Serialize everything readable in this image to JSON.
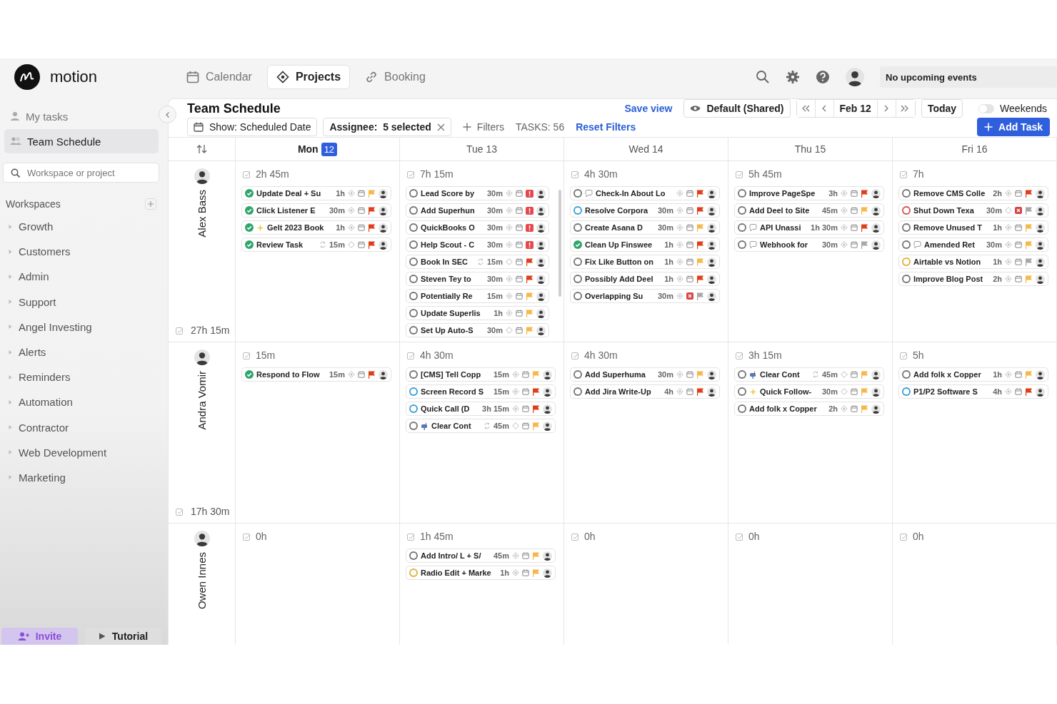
{
  "app": {
    "logo": "motion"
  },
  "nav": [
    {
      "label": "Calendar",
      "selected": false
    },
    {
      "label": "Projects",
      "selected": true
    },
    {
      "label": "Booking",
      "selected": false
    }
  ],
  "events_field": {
    "value": "No upcoming events"
  },
  "sidebar": {
    "items": [
      {
        "label": "My tasks",
        "selected": false
      },
      {
        "label": "Team Schedule",
        "selected": true
      }
    ],
    "search": {
      "placeholder": "Workspace or project"
    },
    "workspaces_title": "Workspaces",
    "workspaces": [
      {
        "label": "Growth",
        "expanded": false
      },
      {
        "label": "Customers",
        "expanded": false
      },
      {
        "label": "Admin",
        "expanded": false
      },
      {
        "label": "Support",
        "expanded": false
      },
      {
        "label": "Angel Investing",
        "expanded": false
      },
      {
        "label": "Alerts",
        "expanded": false
      },
      {
        "label": "Reminders",
        "expanded": false
      },
      {
        "label": "Automation",
        "expanded": false
      },
      {
        "label": "Contractor",
        "expanded": false
      },
      {
        "label": "Web Development",
        "expanded": false
      },
      {
        "label": "Marketing",
        "expanded": false
      }
    ],
    "footer": [
      {
        "label": "Invite",
        "kind": "invite"
      },
      {
        "label": "Tutorial",
        "kind": "tutorial"
      }
    ]
  },
  "toolbar": {
    "title": "Team Schedule",
    "save_view": "Save view",
    "view": "Default (Shared)",
    "date": "Feb 12",
    "today": "Today",
    "weekends": {
      "label": "Weekends",
      "on": false
    },
    "show": "Show: Scheduled Date",
    "assignee": "Assignee:  5 selected",
    "filters": "Filters",
    "tasks_count": "TASKS: 56",
    "reset": "Reset Filters",
    "add_task": "Add Task"
  },
  "days": [
    {
      "label": "Mon",
      "date": "12",
      "today": true
    },
    {
      "label": "Tue",
      "date": "13",
      "today": false
    },
    {
      "label": "Wed",
      "date": "14",
      "today": false
    },
    {
      "label": "Thu",
      "date": "15",
      "today": false
    },
    {
      "label": "Fri",
      "date": "16",
      "today": false
    }
  ],
  "rows": [
    {
      "name": "Alex Bass",
      "total": "27h 15m",
      "cells": [
        {
          "total": "2h 45m",
          "scrollable": false,
          "tasks": [
            {
              "done": true,
              "color": "#2ea56b",
              "kind": "plain",
              "title": "Update Deal + Su",
              "recurring": false,
              "duration": "1h",
              "scheduled": true,
              "deadline_missed": false,
              "priority": {
                "urgent": false,
                "color": "#f5b84a"
              }
            },
            {
              "done": true,
              "color": "#2ea56b",
              "kind": "plain",
              "title": "Click Listener E",
              "recurring": false,
              "duration": "30m",
              "scheduled": true,
              "deadline_missed": false,
              "priority": {
                "urgent": false,
                "color": "#e03e1a"
              }
            },
            {
              "done": true,
              "color": "#2ea56b",
              "kind": "sparkle",
              "title": "Gelt 2023 Book",
              "recurring": false,
              "duration": "1h",
              "scheduled": true,
              "deadline_missed": false,
              "priority": {
                "urgent": false,
                "color": "#e03e1a"
              }
            },
            {
              "done": true,
              "color": "#2ea56b",
              "kind": "plain",
              "title": "Review Task",
              "recurring": true,
              "duration": "15m",
              "scheduled": false,
              "deadline_missed": false,
              "priority": {
                "urgent": false,
                "color": "#e03e1a"
              }
            }
          ]
        },
        {
          "total": "7h 15m",
          "scrollable": true,
          "tasks": [
            {
              "done": false,
              "color": "#777777",
              "kind": "plain",
              "title": "Lead Score by",
              "recurring": false,
              "duration": "30m",
              "scheduled": true,
              "deadline_missed": false,
              "priority": {
                "urgent": true,
                "color": "#e5484d"
              }
            },
            {
              "done": false,
              "color": "#777777",
              "kind": "plain",
              "title": "Add Superhun",
              "recurring": false,
              "duration": "30m",
              "scheduled": true,
              "deadline_missed": false,
              "priority": {
                "urgent": true,
                "color": "#e5484d"
              }
            },
            {
              "done": false,
              "color": "#777777",
              "kind": "plain",
              "title": "QuickBooks O",
              "recurring": false,
              "duration": "30m",
              "scheduled": true,
              "deadline_missed": false,
              "priority": {
                "urgent": true,
                "color": "#e5484d"
              }
            },
            {
              "done": false,
              "color": "#777777",
              "kind": "plain",
              "title": "Help Scout - C",
              "recurring": false,
              "duration": "30m",
              "scheduled": true,
              "deadline_missed": false,
              "priority": {
                "urgent": true,
                "color": "#e5484d"
              }
            },
            {
              "done": false,
              "color": "#777777",
              "kind": "plain",
              "title": "Book In SEC",
              "recurring": true,
              "duration": "15m",
              "scheduled": false,
              "deadline_missed": false,
              "priority": {
                "urgent": false,
                "color": "#e03e1a"
              }
            },
            {
              "done": false,
              "color": "#777777",
              "kind": "plain",
              "title": "Steven Tey to",
              "recurring": false,
              "duration": "30m",
              "scheduled": true,
              "deadline_missed": false,
              "priority": {
                "urgent": false,
                "color": "#e03e1a"
              }
            },
            {
              "done": false,
              "color": "#777777",
              "kind": "plain",
              "title": "Potentially Re",
              "recurring": false,
              "duration": "15m",
              "scheduled": true,
              "deadline_missed": false,
              "priority": {
                "urgent": false,
                "color": "#f5b84a"
              }
            },
            {
              "done": false,
              "color": "#777777",
              "kind": "plain",
              "title": "Update Superlis",
              "recurring": false,
              "duration": "1h",
              "scheduled": true,
              "deadline_missed": false,
              "priority": {
                "urgent": false,
                "color": "#f5b84a"
              }
            },
            {
              "done": false,
              "color": "#777777",
              "kind": "plain",
              "title": "Set Up Auto-S",
              "recurring": false,
              "duration": "30m",
              "scheduled": false,
              "deadline_missed": false,
              "priority": {
                "urgent": false,
                "color": "#f5b84a"
              }
            }
          ]
        },
        {
          "total": "4h 30m",
          "scrollable": false,
          "tasks": [
            {
              "done": false,
              "color": "#777777",
              "kind": "chat",
              "title": "Check-In About Lo",
              "recurring": false,
              "scheduled": true,
              "deadline_missed": false,
              "priority": {
                "urgent": false,
                "color": "#e03e1a"
              }
            },
            {
              "done": false,
              "color": "#3aa0d8",
              "kind": "plain",
              "title": "Resolve Corpora",
              "recurring": false,
              "duration": "30m",
              "scheduled": true,
              "deadline_missed": false,
              "priority": {
                "urgent": false,
                "color": "#e03e1a"
              }
            },
            {
              "done": false,
              "color": "#777777",
              "kind": "plain",
              "title": "Create Asana D",
              "recurring": false,
              "duration": "30m",
              "scheduled": true,
              "deadline_missed": false,
              "priority": {
                "urgent": false,
                "color": "#f5b84a"
              }
            },
            {
              "done": true,
              "color": "#2ea56b",
              "kind": "plain",
              "title": "Clean Up Finswee",
              "recurring": false,
              "duration": "1h",
              "scheduled": true,
              "deadline_missed": false,
              "priority": {
                "urgent": false,
                "color": "#e03e1a"
              }
            },
            {
              "done": false,
              "color": "#777777",
              "kind": "plain",
              "title": "Fix Like Button on",
              "recurring": false,
              "duration": "1h",
              "scheduled": true,
              "deadline_missed": false,
              "priority": {
                "urgent": false,
                "color": "#f5b84a"
              }
            },
            {
              "done": false,
              "color": "#777777",
              "kind": "plain",
              "title": "Possibly Add Deel",
              "recurring": false,
              "duration": "1h",
              "scheduled": true,
              "deadline_missed": false,
              "priority": {
                "urgent": false,
                "color": "#e03e1a"
              }
            },
            {
              "done": false,
              "color": "#777777",
              "kind": "plain",
              "title": "Overlapping Su",
              "recurring": false,
              "duration": "30m",
              "scheduled": true,
              "deadline_missed": true,
              "priority": {
                "urgent": false,
                "color": "#a8a8a8"
              }
            }
          ]
        },
        {
          "total": "5h 45m",
          "scrollable": false,
          "tasks": [
            {
              "done": false,
              "color": "#777777",
              "kind": "plain",
              "title": "Improve PageSpe",
              "recurring": false,
              "duration": "3h",
              "scheduled": true,
              "deadline_missed": false,
              "priority": {
                "urgent": false,
                "color": "#e03e1a"
              }
            },
            {
              "done": false,
              "color": "#777777",
              "kind": "plain",
              "title": "Add Deel to Site",
              "recurring": false,
              "duration": "45m",
              "scheduled": true,
              "deadline_missed": false,
              "priority": {
                "urgent": false,
                "color": "#f5b84a"
              }
            },
            {
              "done": false,
              "color": "#777777",
              "kind": "chat",
              "title": "API Unassi",
              "recurring": false,
              "duration": "1h 30m",
              "scheduled": true,
              "deadline_missed": false,
              "priority": {
                "urgent": false,
                "color": "#e03e1a"
              }
            },
            {
              "done": false,
              "color": "#777777",
              "kind": "chat",
              "title": "Webhook for",
              "recurring": false,
              "duration": "30m",
              "scheduled": true,
              "deadline_missed": false,
              "priority": {
                "urgent": false,
                "color": "#a8a8a8"
              }
            }
          ]
        },
        {
          "total": "7h",
          "scrollable": false,
          "tasks": [
            {
              "done": false,
              "color": "#777777",
              "kind": "plain",
              "title": "Remove CMS Colle",
              "recurring": false,
              "duration": "2h",
              "scheduled": true,
              "deadline_missed": false,
              "priority": {
                "urgent": false,
                "color": "#e03e1a"
              }
            },
            {
              "done": false,
              "color": "#d9534f",
              "kind": "plain",
              "title": "Shut Down Texa",
              "recurring": false,
              "duration": "30m",
              "scheduled": false,
              "deadline_missed": true,
              "priority": {
                "urgent": false,
                "color": "#a8a8a8"
              }
            },
            {
              "done": false,
              "color": "#777777",
              "kind": "plain",
              "title": "Remove Unused T",
              "recurring": false,
              "duration": "1h",
              "scheduled": true,
              "deadline_missed": false,
              "priority": {
                "urgent": false,
                "color": "#f5b84a"
              }
            },
            {
              "done": false,
              "color": "#777777",
              "kind": "chat",
              "title": "Amended Ret",
              "recurring": false,
              "duration": "30m",
              "scheduled": true,
              "deadline_missed": false,
              "priority": {
                "urgent": false,
                "color": "#f5b84a"
              }
            },
            {
              "done": false,
              "color": "#e2b33c",
              "kind": "plain",
              "title": "Airtable vs Notion",
              "recurring": false,
              "duration": "1h",
              "scheduled": true,
              "deadline_missed": false,
              "priority": {
                "urgent": false,
                "color": "#a8a8a8"
              }
            },
            {
              "done": false,
              "color": "#777777",
              "kind": "plain",
              "title": "Improve Blog Post",
              "recurring": false,
              "duration": "2h",
              "scheduled": true,
              "deadline_missed": false,
              "priority": {
                "urgent": false,
                "color": "#f5b84a"
              }
            }
          ]
        }
      ]
    },
    {
      "name": "Andra Vomir",
      "total": "17h 30m",
      "cells": [
        {
          "total": "15m",
          "scrollable": false,
          "tasks": [
            {
              "done": true,
              "color": "#2ea56b",
              "kind": "plain",
              "title": "Respond to Flow",
              "recurring": false,
              "duration": "15m",
              "scheduled": true,
              "deadline_missed": false,
              "priority": {
                "urgent": false,
                "color": "#e03e1a"
              }
            }
          ]
        },
        {
          "total": "4h 30m",
          "scrollable": false,
          "tasks": [
            {
              "done": false,
              "color": "#777777",
              "kind": "plain",
              "title": "[CMS] Tell Copp",
              "recurring": false,
              "duration": "15m",
              "scheduled": true,
              "deadline_missed": false,
              "priority": {
                "urgent": false,
                "color": "#f5b84a"
              }
            },
            {
              "done": false,
              "color": "#3aa0d8",
              "kind": "plain",
              "title": "Screen Record S",
              "recurring": false,
              "duration": "15m",
              "scheduled": true,
              "deadline_missed": false,
              "priority": {
                "urgent": false,
                "color": "#e03e1a"
              }
            },
            {
              "done": false,
              "color": "#3aa0d8",
              "kind": "plain",
              "title": "Quick Call (D",
              "recurring": false,
              "duration": "3h 15m",
              "scheduled": true,
              "deadline_missed": false,
              "priority": {
                "urgent": false,
                "color": "#e03e1a"
              }
            },
            {
              "done": false,
              "color": "#777777",
              "kind": "mailbox",
              "title": "Clear Cont",
              "recurring": true,
              "duration": "45m",
              "scheduled": false,
              "deadline_missed": false,
              "priority": {
                "urgent": false,
                "color": "#f5b84a"
              }
            }
          ]
        },
        {
          "total": "4h 30m",
          "scrollable": false,
          "tasks": [
            {
              "done": false,
              "color": "#777777",
              "kind": "plain",
              "title": "Add Superhuma",
              "recurring": false,
              "duration": "30m",
              "scheduled": true,
              "deadline_missed": false,
              "priority": {
                "urgent": false,
                "color": "#f5b84a"
              }
            },
            {
              "done": false,
              "color": "#777777",
              "kind": "plain",
              "title": "Add Jira Write-Up",
              "recurring": false,
              "duration": "4h",
              "scheduled": true,
              "deadline_missed": false,
              "priority": {
                "urgent": false,
                "color": "#e03e1a"
              }
            }
          ]
        },
        {
          "total": "3h 15m",
          "scrollable": false,
          "tasks": [
            {
              "done": false,
              "color": "#777777",
              "kind": "mailbox",
              "title": "Clear Cont",
              "recurring": true,
              "duration": "45m",
              "scheduled": false,
              "deadline_missed": false,
              "priority": {
                "urgent": false,
                "color": "#f5b84a"
              }
            },
            {
              "done": false,
              "color": "#777777",
              "kind": "sparkle",
              "title": "Quick Follow-",
              "recurring": false,
              "duration": "30m",
              "scheduled": false,
              "deadline_missed": false,
              "priority": {
                "urgent": false,
                "color": "#f5b84a"
              }
            },
            {
              "done": false,
              "color": "#777777",
              "kind": "plain",
              "title": "Add folk x Copper",
              "recurring": false,
              "duration": "2h",
              "scheduled": true,
              "deadline_missed": false,
              "priority": {
                "urgent": false,
                "color": "#f5b84a"
              }
            }
          ]
        },
        {
          "total": "5h",
          "scrollable": false,
          "tasks": [
            {
              "done": false,
              "color": "#777777",
              "kind": "plain",
              "title": "Add folk x Copper",
              "recurring": false,
              "duration": "1h",
              "scheduled": true,
              "deadline_missed": false,
              "priority": {
                "urgent": false,
                "color": "#f5b84a"
              }
            },
            {
              "done": false,
              "color": "#3aa0d8",
              "kind": "plain",
              "title": "P1/P2 Software S",
              "recurring": false,
              "duration": "4h",
              "scheduled": true,
              "deadline_missed": false,
              "priority": {
                "urgent": false,
                "color": "#e03e1a"
              }
            }
          ]
        }
      ]
    },
    {
      "name": "Owen Innes",
      "cells": [
        {
          "total": "0h",
          "scrollable": false
        },
        {
          "total": "1h 45m",
          "scrollable": false,
          "tasks": [
            {
              "done": false,
              "color": "#777777",
              "kind": "plain",
              "title": "Add Intro/ L + S/",
              "recurring": false,
              "duration": "45m",
              "scheduled": true,
              "deadline_missed": false,
              "priority": {
                "urgent": false,
                "color": "#f5b84a"
              }
            },
            {
              "done": false,
              "color": "#e2b33c",
              "kind": "plain",
              "title": "Radio Edit + Marke",
              "recurring": false,
              "duration": "1h",
              "scheduled": true,
              "deadline_missed": false,
              "priority": {
                "urgent": false,
                "color": "#f5b84a"
              }
            }
          ]
        },
        {
          "total": "0h",
          "scrollable": false
        },
        {
          "total": "0h",
          "scrollable": false
        },
        {
          "total": "0h",
          "scrollable": false
        }
      ]
    }
  ]
}
